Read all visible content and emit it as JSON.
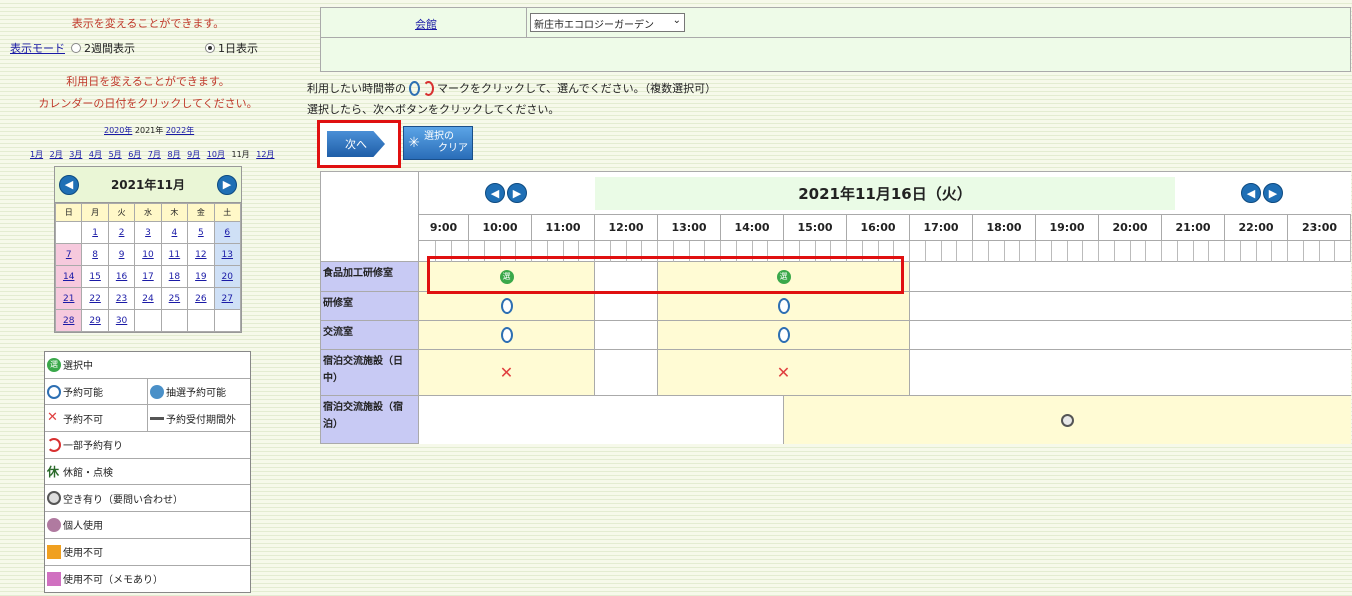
{
  "left": {
    "note1": "表示を変えることができます。",
    "mode_label": "表示モード",
    "mode_two_weeks": "2週間表示",
    "mode_one_day": "1日表示",
    "note2": "利用日を変えることができます。",
    "note3": "カレンダーの日付をクリックしてください。",
    "years": {
      "prev": "2020年",
      "current": "2021年",
      "next": "2022年"
    },
    "months": [
      "1月",
      "2月",
      "3月",
      "4月",
      "5月",
      "6月",
      "7月",
      "8月",
      "9月",
      "10月",
      "11月",
      "12月"
    ],
    "calendar": {
      "title": "2021年11月",
      "dow": [
        "日",
        "月",
        "火",
        "水",
        "木",
        "金",
        "土"
      ],
      "weeks": [
        [
          "",
          "1",
          "2",
          "3",
          "4",
          "5",
          "6"
        ],
        [
          "7",
          "8",
          "9",
          "10",
          "11",
          "12",
          "13"
        ],
        [
          "14",
          "15",
          "16",
          "17",
          "18",
          "19",
          "20"
        ],
        [
          "21",
          "22",
          "23",
          "24",
          "25",
          "26",
          "27"
        ],
        [
          "28",
          "29",
          "30",
          "",
          "",
          "",
          ""
        ]
      ]
    },
    "legend": {
      "selected": "選択中",
      "available": "予約可能",
      "lottery": "抽選予約可能",
      "unavailable": "予約不可",
      "outside_period": "予約受付期間外",
      "partial": "一部予約有り",
      "closed": "休館・点検",
      "inquiry": "空き有り（要問い合わせ）",
      "personal": "個人使用",
      "not_usable": "使用不可",
      "not_usable_memo": "使用不可（メモあり）"
    }
  },
  "facility": {
    "label": "会館",
    "selected": "新庄市エコロジーガーデン"
  },
  "instructions": {
    "line1a": "利用したい時間帯の",
    "line1b": "マークをクリックして、選んでください。（複数選択可）",
    "line2": "選択したら、次へボタンをクリックしてください。"
  },
  "buttons": {
    "next": "次へ",
    "clear_line1": "選択の",
    "clear_line2": "クリア"
  },
  "schedule": {
    "date": "2021年11月16日（火）",
    "hours": [
      "9:00",
      "10:00",
      "11:00",
      "12:00",
      "13:00",
      "14:00",
      "15:00",
      "16:00",
      "17:00",
      "18:00",
      "19:00",
      "20:00",
      "21:00",
      "22:00",
      "23:00"
    ],
    "rooms": [
      "食品加工研修室",
      "研修室",
      "交流室",
      "宿泊交流施設（日中）",
      "宿泊交流施設（宿泊）"
    ],
    "selected_mark": "選"
  }
}
